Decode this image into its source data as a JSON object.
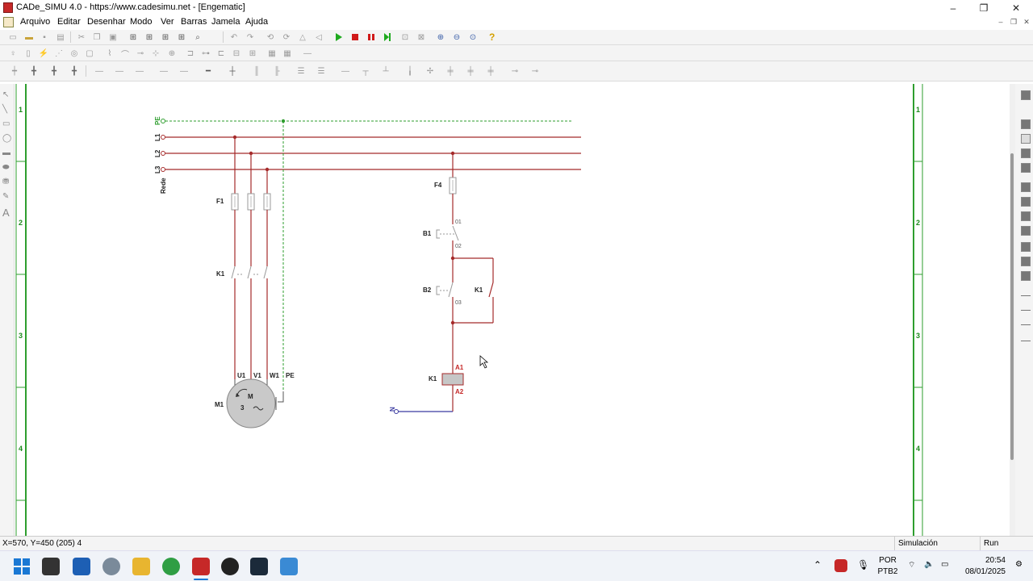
{
  "window": {
    "title": "CADe_SIMU 4.0 - https://www.cadesimu.net - [Engematic]",
    "controls": {
      "minimize": "–",
      "restore": "❐",
      "close": "✕"
    }
  },
  "menu": {
    "items": [
      "Arquivo",
      "Editar",
      "Desenhar",
      "Modo",
      "Ver",
      "Barras",
      "Jamela",
      "Ajuda"
    ],
    "mdi_controls": {
      "minimize": "–",
      "restore": "❐",
      "close": "✕"
    }
  },
  "toolbar": {
    "sim_colors": {
      "play": "#1faa1f",
      "stop": "#d01a1a",
      "pause": "#d01a1a",
      "step": "#1faa1f",
      "help": "#d4a000"
    }
  },
  "diagram": {
    "wire_color": "#a52a2a",
    "pe_color": "#2e9e2e",
    "neutral_color": "#3a3aa0",
    "bus_labels": [
      "PE",
      "L1",
      "L2",
      "L3"
    ],
    "network_label": "Rede",
    "row_numbers": [
      "1",
      "2",
      "3",
      "4"
    ],
    "components": {
      "fuses_power": "F1",
      "contactor_power": "K1",
      "motor": "M1",
      "motor_terminals": [
        "U1",
        "V1",
        "W1",
        "PE"
      ],
      "motor_symbol_top": "M",
      "motor_symbol_bottom": "3",
      "fuse_control": "F4",
      "stop_button": "B1",
      "stop_contacts": [
        "01",
        "02"
      ],
      "start_button": "B2",
      "start_contact": "03",
      "seal_contact": "K1",
      "coil": "K1",
      "coil_terminals": [
        "A1",
        "A2"
      ],
      "neutral_label": "N"
    }
  },
  "status": {
    "coords": "X=570, Y=450 (205) 4",
    "mode": "Simulación",
    "run": "Run"
  },
  "taskbar": {
    "lang_top": "POR",
    "lang_bottom": "PTB2",
    "time": "20:54",
    "date": "08/01/2025"
  }
}
